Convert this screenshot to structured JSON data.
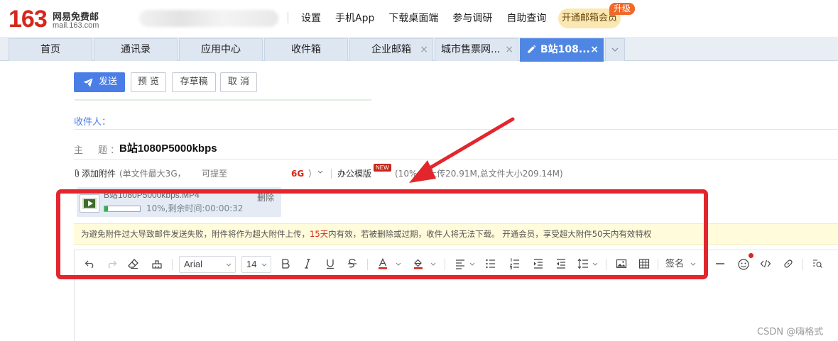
{
  "header": {
    "logo_number": "163",
    "logo_name": "网易免费邮",
    "logo_domain": "mail.163.com",
    "nav_items": [
      "设置",
      "手机App",
      "下载桌面端",
      "参与调研",
      "自助查询"
    ],
    "vip_button": "开通邮箱会员",
    "upgrade_badge": "升级"
  },
  "tabs": {
    "items": [
      {
        "label": "首页",
        "closable": false,
        "active": false
      },
      {
        "label": "通讯录",
        "closable": false,
        "active": false
      },
      {
        "label": "应用中心",
        "closable": false,
        "active": false
      },
      {
        "label": "收件箱",
        "closable": false,
        "active": false
      },
      {
        "label": "企业邮箱",
        "closable": true,
        "active": false
      },
      {
        "label": "城市售票网...",
        "closable": true,
        "active": false
      },
      {
        "label": "B站108...",
        "closable": true,
        "active": true
      }
    ],
    "close_glyph": "×"
  },
  "compose": {
    "send_label": "发送",
    "preview_label": "预 览",
    "draft_label": "存草稿",
    "cancel_label": "取 消",
    "recipient_label": "收件人：",
    "subject_label": "主　题：",
    "subject_value": "B站1080P5000kbps"
  },
  "attachments": {
    "add_label": "添加附件",
    "limit_text": "(单文件最大3G，",
    "upgrade_text": "可提至",
    "upgrade_size": "6G",
    "paren_close": "）",
    "office_template": "办公模版",
    "new_badge": "NEW",
    "upload_progress": "(10%,已上传20.91M,总文件大小209.14M)",
    "file": {
      "name": "B站1080P5000kbps.MP4",
      "progress": 0.1,
      "status": "10%,剩余时间:00:00:32",
      "delete_label": "删除"
    }
  },
  "notice": {
    "text_before": "为避免附件过大导致邮件发送失败，附件将作为超大附件上传，",
    "days": "15天",
    "text_after": "内有效，若被删除或过期，收件人将无法下载。 开通会员，享受超大附件50天内有效特权"
  },
  "toolbar": {
    "font_family": "Arial",
    "font_size": "14",
    "signature_label": "签名"
  },
  "colors": {
    "brand_red": "#d7261b",
    "accent_blue": "#4a7ee6",
    "annotation_red": "#e3262e"
  },
  "watermark": "CSDN @嗨格式"
}
